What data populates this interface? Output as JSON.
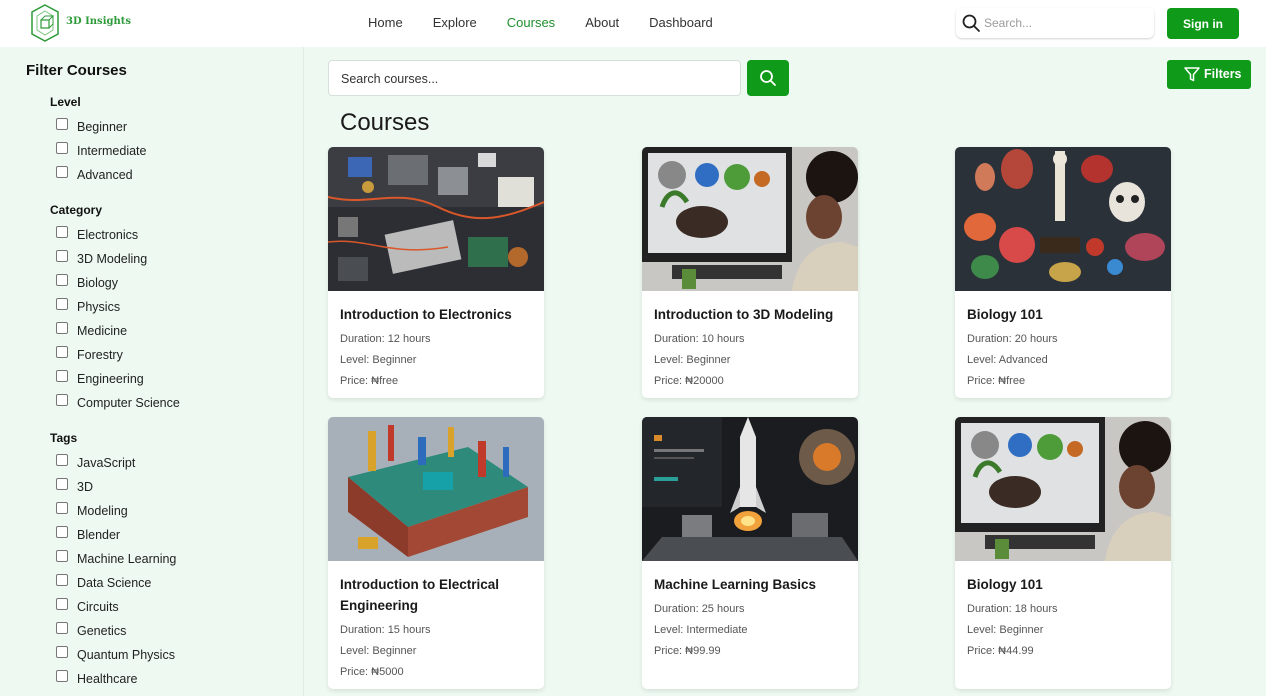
{
  "brand": {
    "name": "3D Insights"
  },
  "nav": [
    {
      "label": "Home",
      "active": false
    },
    {
      "label": "Explore",
      "active": false
    },
    {
      "label": "Courses",
      "active": true
    },
    {
      "label": "About",
      "active": false
    },
    {
      "label": "Dashboard",
      "active": false
    }
  ],
  "header": {
    "search_placeholder": "Search...",
    "signin_label": "Sign in"
  },
  "sidebar": {
    "title": "Filter Courses",
    "groups": [
      {
        "title": "Level",
        "options": [
          "Beginner",
          "Intermediate",
          "Advanced"
        ]
      },
      {
        "title": "Category",
        "options": [
          "Electronics",
          "3D Modeling",
          "Biology",
          "Physics",
          "Medicine",
          "Forestry",
          "Engineering",
          "Computer Science"
        ]
      },
      {
        "title": "Tags",
        "options": [
          "JavaScript",
          "3D",
          "Modeling",
          "Blender",
          "Machine Learning",
          "Data Science",
          "Circuits",
          "Genetics",
          "Quantum Physics",
          "Healthcare"
        ]
      }
    ]
  },
  "main": {
    "search_placeholder": "Search courses...",
    "filters_label": "Filters",
    "title": "Courses"
  },
  "courses": [
    {
      "title": "Introduction to Electronics",
      "duration": "Duration: 12 hours",
      "level": "Level: Beginner",
      "price": "Price: ₦free",
      "image": "electronics-components"
    },
    {
      "title": "Introduction to 3D Modeling",
      "duration": "Duration: 10 hours",
      "level": "Level: Beginner",
      "price": "Price: ₦20000",
      "image": "woman-at-computer"
    },
    {
      "title": "Biology 101",
      "duration": "Duration: 20 hours",
      "level": "Level: Advanced",
      "price": "Price: ₦free",
      "image": "anatomy-models"
    },
    {
      "title": "Introduction to Electrical Engineering",
      "duration": "Duration: 15 hours",
      "level": "Level: Beginner",
      "price": "Price: ₦5000",
      "image": "circuit-board-model"
    },
    {
      "title": "Machine Learning Basics",
      "duration": "Duration: 25 hours",
      "level": "Level: Intermediate",
      "price": "Price: ₦99.99",
      "image": "rocket-launch"
    },
    {
      "title": "Biology 101",
      "duration": "Duration: 18 hours",
      "level": "Level: Beginner",
      "price": "Price: ₦44.99",
      "image": "woman-at-computer"
    }
  ],
  "colors": {
    "accent": "#0f9a1a",
    "background": "#eefaf1",
    "nav_active": "#1f8f2e"
  }
}
